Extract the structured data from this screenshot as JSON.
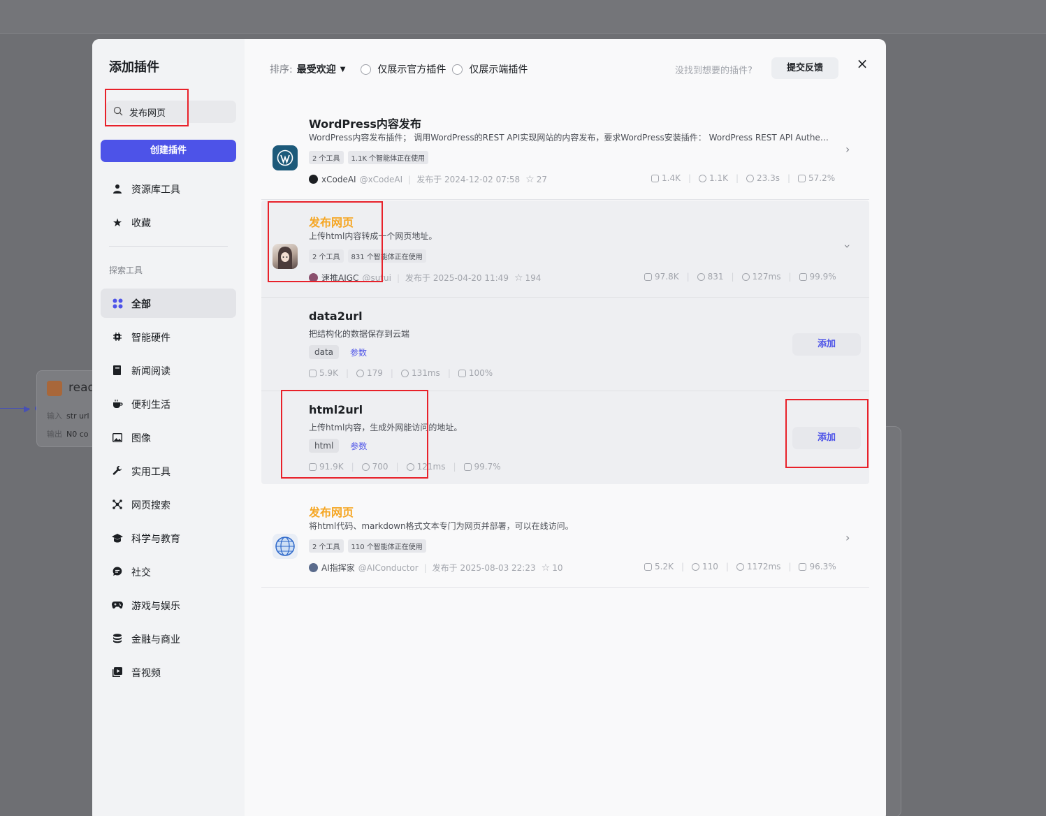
{
  "background": {
    "node_title": "read",
    "node_input_label": "输入",
    "node_input_value": "str url",
    "node_output_label": "输出",
    "node_output_value": "N0 co"
  },
  "modal": {
    "title": "添加插件",
    "search": {
      "value": "发布网页"
    },
    "create_button": "创建插件",
    "close_label": "×"
  },
  "sidebar": {
    "top_items": [
      {
        "label": "资源库工具",
        "icon": "user-icon"
      },
      {
        "label": "收藏",
        "icon": "star-icon"
      }
    ],
    "section_label": "探索工具",
    "categories": [
      {
        "label": "全部",
        "icon": "grid-icon",
        "active": true
      },
      {
        "label": "智能硬件",
        "icon": "chip-icon"
      },
      {
        "label": "新闻阅读",
        "icon": "book-icon"
      },
      {
        "label": "便利生活",
        "icon": "cup-icon"
      },
      {
        "label": "图像",
        "icon": "image-icon"
      },
      {
        "label": "实用工具",
        "icon": "wrench-icon"
      },
      {
        "label": "网页搜索",
        "icon": "network-icon"
      },
      {
        "label": "科学与教育",
        "icon": "graduation-cap-icon"
      },
      {
        "label": "社交",
        "icon": "chat-icon"
      },
      {
        "label": "游戏与娱乐",
        "icon": "gamepad-icon"
      },
      {
        "label": "金融与商业",
        "icon": "coins-icon"
      },
      {
        "label": "音视频",
        "icon": "play-icon"
      }
    ]
  },
  "toolbar": {
    "sort_label": "排序:",
    "sort_value": "最受欢迎",
    "filter_official": "仅展示官方插件",
    "filter_client": "仅展示端插件",
    "hint": "没找到想要的插件?",
    "feedback_button": "提交反馈"
  },
  "plugins": [
    {
      "title": "WordPress内容发布",
      "desc": "WordPress内容发布插件； 调用WordPress的REST API实现网站的内容发布，要求WordPress安装插件： WordPress REST API Authenti…",
      "tag_tools": "2 个工具",
      "tag_usage": "1.1K 个智能体正在使用",
      "author": "xCodeAI",
      "handle": "@xCodeAI",
      "published": "发布于 2024-12-02 07:58",
      "stars": "27",
      "stat1": "1.4K",
      "stat2": "1.1K",
      "stat3": "23.3s",
      "stat4": "57.2%"
    },
    {
      "title": "发布网页",
      "desc": "上传html内容转成一个网页地址。",
      "tag_tools": "2 个工具",
      "tag_usage": "831 个智能体正在使用",
      "author": "速推AIGC",
      "handle": "@sutui",
      "published": "发布于 2025-04-20 11:49",
      "stars": "194",
      "stat1": "97.8K",
      "stat2": "831",
      "stat3": "127ms",
      "stat4": "99.9%",
      "tools": [
        {
          "name": "data2url",
          "desc": "把结构化的数据保存到云端",
          "param": "data",
          "param_link": "参数",
          "stat1": "5.9K",
          "stat2": "179",
          "stat3": "131ms",
          "stat4": "100%",
          "add": "添加"
        },
        {
          "name": "html2url",
          "desc": "上传html内容，生成外网能访问的地址。",
          "param": "html",
          "param_link": "参数",
          "stat1": "91.9K",
          "stat2": "700",
          "stat3": "121ms",
          "stat4": "99.7%",
          "add": "添加"
        }
      ]
    },
    {
      "title": "发布网页",
      "desc": "将html代码、markdown格式文本专门为网页并部署，可以在线访问。",
      "tag_tools": "2 个工具",
      "tag_usage": "110 个智能体正在使用",
      "author": "AI指挥家",
      "handle": "@AIConductor",
      "published": "发布于 2025-08-03 22:23",
      "stars": "10",
      "stat1": "5.2K",
      "stat2": "110",
      "stat3": "1172ms",
      "stat4": "96.3%"
    }
  ]
}
